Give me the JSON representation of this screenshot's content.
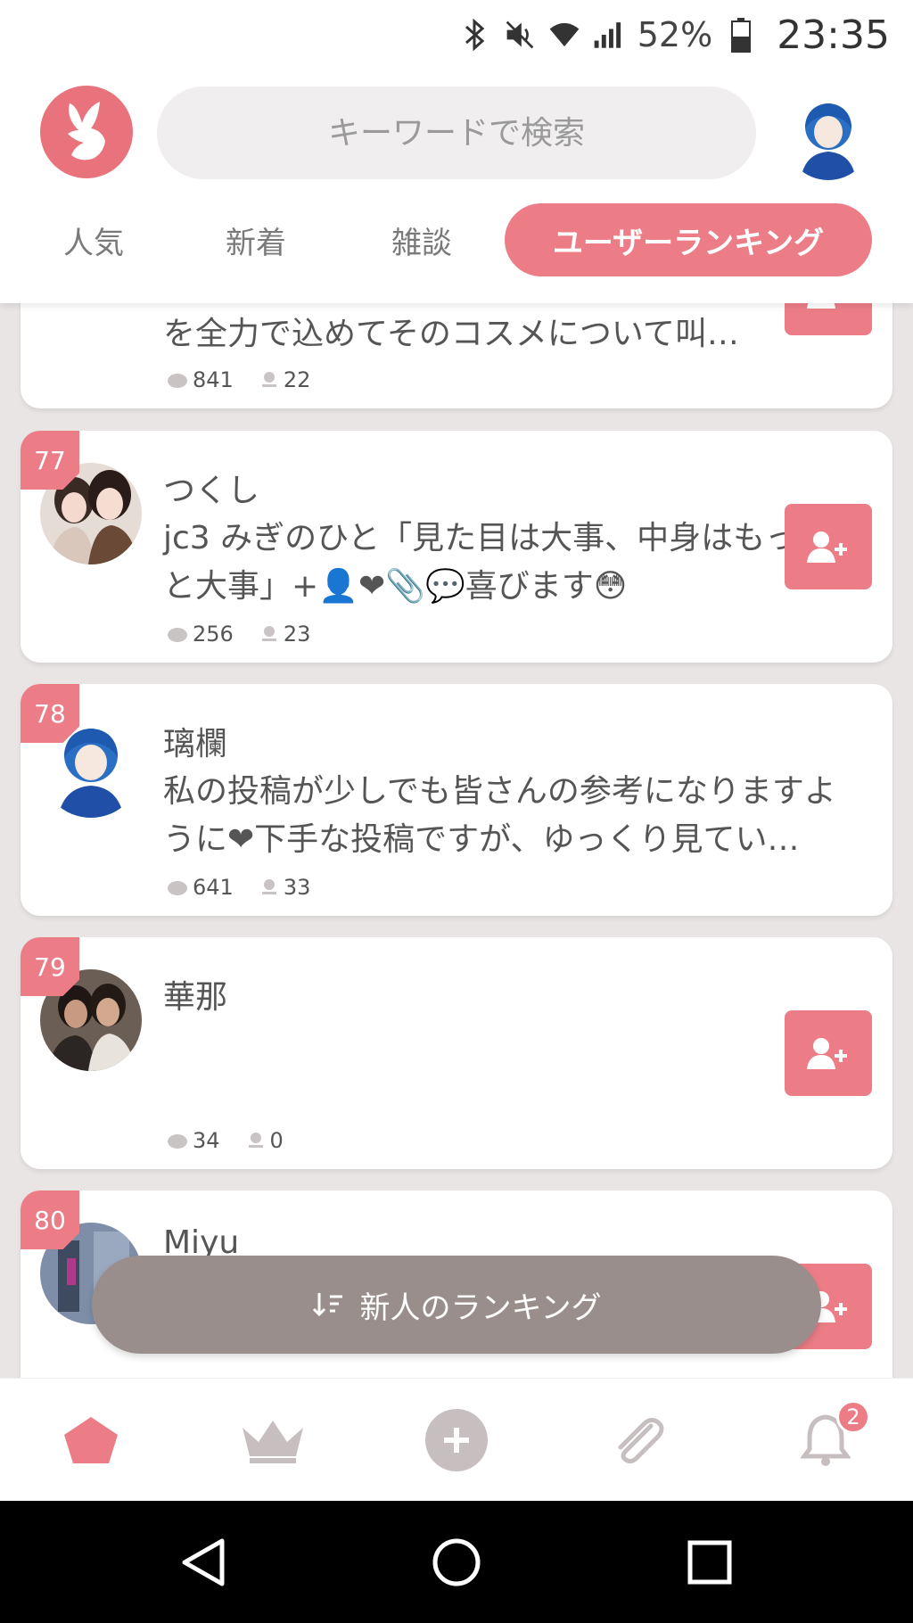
{
  "status_bar": {
    "battery_pct": "52%",
    "clock": "23:35"
  },
  "header": {
    "search_placeholder": "キーワードで検索",
    "tabs": [
      {
        "label": "人気"
      },
      {
        "label": "新着"
      },
      {
        "label": "雑談"
      },
      {
        "label": "ユーザーランキング"
      }
    ]
  },
  "users": [
    {
      "rank": "",
      "name": "",
      "bio": "を全力で込めてそのコスメについて叫…",
      "likes": "841",
      "comments": "22"
    },
    {
      "rank": "77",
      "name": "つくし",
      "bio": "jc3 みぎのひと「見た目は大事、中身はもっと大事」+👤❤📎💬喜びます😳",
      "likes": "256",
      "comments": "23"
    },
    {
      "rank": "78",
      "name": "璃欄",
      "bio": "私の投稿が少しでも皆さんの参考になりますように❤下手な投稿ですが、ゆっくり見てい…",
      "likes": "641",
      "comments": "33"
    },
    {
      "rank": "79",
      "name": "華那",
      "bio": "",
      "likes": "34",
      "comments": "0"
    },
    {
      "rank": "80",
      "name": "Miyu",
      "bio": "",
      "likes": "",
      "comments": ""
    }
  ],
  "sort_button": {
    "label": "新人のランキング"
  },
  "bottom_nav": {
    "notification_badge": "2"
  },
  "colors": {
    "accent": "#ec7d87",
    "sort_button": "#9a8e8c",
    "background": "#e9e5e5"
  }
}
